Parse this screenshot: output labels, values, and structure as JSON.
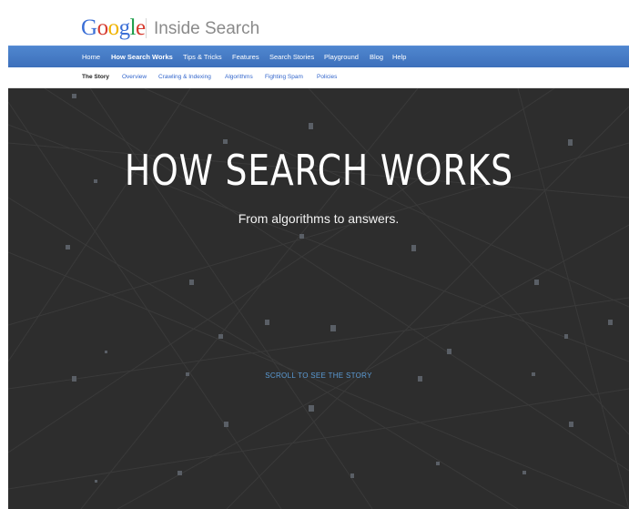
{
  "header": {
    "logo_letters": [
      {
        "char": "G",
        "color": "#3b6fd6"
      },
      {
        "char": "o",
        "color": "#d63b2f"
      },
      {
        "char": "o",
        "color": "#f0b400"
      },
      {
        "char": "g",
        "color": "#3b6fd6"
      },
      {
        "char": "l",
        "color": "#1a9c47"
      },
      {
        "char": "e",
        "color": "#d63b2f"
      }
    ],
    "site_title": "Inside Search"
  },
  "main_nav": {
    "items": [
      {
        "label": "Home",
        "active": false
      },
      {
        "label": "How Search Works",
        "active": true
      },
      {
        "label": "Tips & Tricks",
        "active": false
      },
      {
        "label": "Features",
        "active": false
      },
      {
        "label": "Search Stories",
        "active": false
      },
      {
        "label": "Playground",
        "active": false
      },
      {
        "label": "Blog",
        "active": false
      },
      {
        "label": "Help",
        "active": false
      }
    ]
  },
  "sub_nav": {
    "items": [
      {
        "label": "The Story",
        "active": true
      },
      {
        "label": "Overview",
        "active": false
      },
      {
        "label": "Crawling & Indexing",
        "active": false
      },
      {
        "label": "Algorithms",
        "active": false
      },
      {
        "label": "Fighting Spam",
        "active": false
      },
      {
        "label": "Policies",
        "active": false
      }
    ]
  },
  "hero": {
    "title": "HOW SEARCH WORKS",
    "subtitle": "From algorithms to answers.",
    "scroll_cta": "SCROLL TO SEE THE STORY",
    "background_color": "#2d2d2d",
    "accent_color": "#5b9bd5"
  }
}
